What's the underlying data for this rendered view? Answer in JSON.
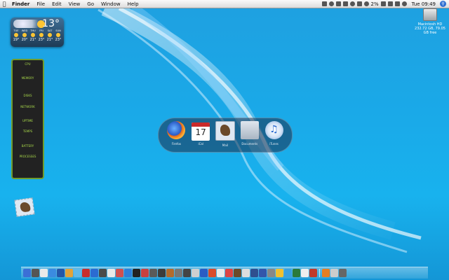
{
  "menubar": {
    "items": [
      "Finder",
      "File",
      "Edit",
      "View",
      "Go",
      "Window",
      "Help"
    ],
    "battery": "2%",
    "clock": "Tue 09:49"
  },
  "desktop": {
    "hd_label_1": "Macintosh HD",
    "hd_label_2": "232.72 GB, 79.05 GB free"
  },
  "weather": {
    "temp": "13°",
    "days": [
      {
        "name": "TUE",
        "temp": "19°"
      },
      {
        "name": "WED",
        "temp": "20°"
      },
      {
        "name": "THU",
        "temp": "21°"
      },
      {
        "name": "FRI",
        "temp": "23°"
      },
      {
        "name": "SAT",
        "temp": "21°"
      },
      {
        "name": "SUN",
        "temp": "23°"
      }
    ]
  },
  "istat": {
    "sections": [
      "CPU",
      "MEMORY",
      "DISKS",
      "NETWORK",
      "UPTIME",
      "TEMPS",
      "BATTERY",
      "PROCESSES"
    ]
  },
  "front_row": {
    "items": [
      {
        "label": "Firefox",
        "icon": "firefox-icon"
      },
      {
        "label": "iCal",
        "icon": "ical-icon",
        "date": "17"
      },
      {
        "label": "Mail",
        "icon": "mail-icon"
      },
      {
        "label": "Documents",
        "icon": "folder-icon"
      },
      {
        "label": "iTunes",
        "icon": "itunes-icon"
      }
    ]
  },
  "dock": {
    "colors": [
      "#3b6fd6",
      "#555",
      "#e9e9e9",
      "#3a8be0",
      "#2456a8",
      "#e2a23a",
      "#5fb8ea",
      "#c82d2d",
      "#2b6bd1",
      "#4a4a4a",
      "#e9e9e9",
      "#d05050",
      "#2d7fd9",
      "#222",
      "#c94040",
      "#5a5a5a",
      "#3c3c3c",
      "#b36b2d",
      "#777",
      "#444",
      "#cfcfcf",
      "#2a5cc4",
      "#d94b2b",
      "#e9e9e9",
      "#d44",
      "#6b4a2a",
      "#ddd",
      "#2f4f8f",
      "#35a",
      "#888",
      "#f0c030",
      "#3aa0e0",
      "#2a7a3a",
      "#eee",
      "#c0392b",
      "#e67e22",
      "#ccc",
      "#666"
    ]
  }
}
